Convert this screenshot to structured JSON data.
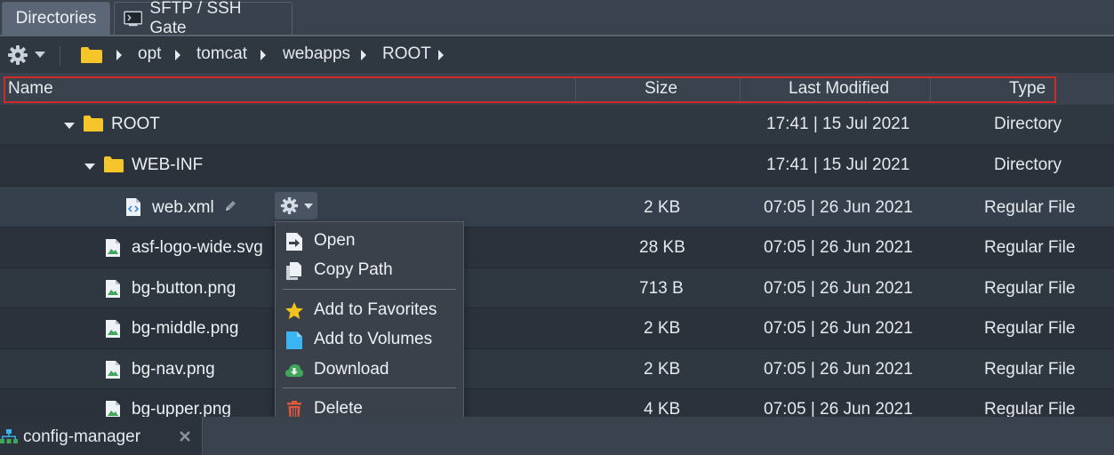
{
  "tabs": [
    {
      "label": "Directories",
      "active": true
    },
    {
      "label": "SFTP / SSH Gate",
      "active": false
    }
  ],
  "breadcrumb": [
    "opt",
    "tomcat",
    "webapps",
    "ROOT"
  ],
  "columns": {
    "name": "Name",
    "size": "Size",
    "modified": "Last Modified",
    "type": "Type"
  },
  "rows": [
    {
      "name": "ROOT",
      "size": "",
      "modified": "17:41 | 15 Jul 2021",
      "type": "Directory",
      "icon": "folder-icon",
      "expanded": true
    },
    {
      "name": "WEB-INF",
      "size": "",
      "modified": "17:41 | 15 Jul 2021",
      "type": "Directory",
      "icon": "folder-icon",
      "expanded": true
    },
    {
      "name": "web.xml",
      "size": "2 KB",
      "modified": "07:05 | 26 Jun 2021",
      "type": "Regular File",
      "icon": "xml-file-icon"
    },
    {
      "name": "asf-logo-wide.svg",
      "size": "28 KB",
      "modified": "07:05 | 26 Jun 2021",
      "type": "Regular File",
      "icon": "image-file-icon"
    },
    {
      "name": "bg-button.png",
      "size": "713 B",
      "modified": "07:05 | 26 Jun 2021",
      "type": "Regular File",
      "icon": "image-file-icon"
    },
    {
      "name": "bg-middle.png",
      "size": "2 KB",
      "modified": "07:05 | 26 Jun 2021",
      "type": "Regular File",
      "icon": "image-file-icon"
    },
    {
      "name": "bg-nav.png",
      "size": "2 KB",
      "modified": "07:05 | 26 Jun 2021",
      "type": "Regular File",
      "icon": "image-file-icon"
    },
    {
      "name": "bg-upper.png",
      "size": "4 KB",
      "modified": "07:05 | 26 Jun 2021",
      "type": "Regular File",
      "icon": "image-file-icon"
    }
  ],
  "context_menu": [
    {
      "label": "Open",
      "icon": "open-icon"
    },
    {
      "label": "Copy Path",
      "icon": "copy-icon"
    },
    {
      "label": "Add to Favorites",
      "icon": "star-icon"
    },
    {
      "label": "Add to Volumes",
      "icon": "volume-icon"
    },
    {
      "label": "Download",
      "icon": "download-cloud-icon"
    },
    {
      "label": "Delete",
      "icon": "trash-icon"
    }
  ],
  "bottom_tab": {
    "label": "config-manager"
  },
  "colors": {
    "folder": "#f5c52a",
    "highlight": "#d22a2a",
    "star": "#f3c21b",
    "volume": "#3ab4f2",
    "download": "#3fa65a",
    "delete": "#e0573e"
  }
}
